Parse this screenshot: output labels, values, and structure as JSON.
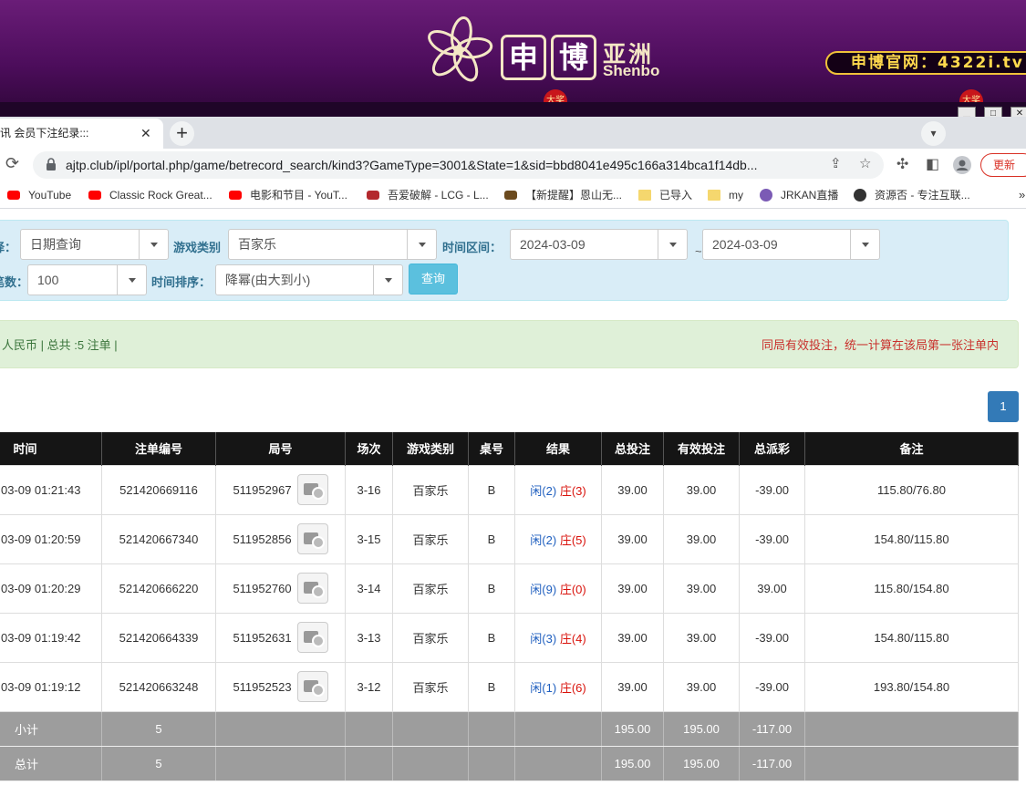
{
  "banner": {
    "brand_box_1": "申",
    "brand_box_2": "博",
    "brand_asia": "亚洲",
    "brand_en": "Shenbo",
    "site_url": "申博官网：4322i.tv",
    "hot_badge": "大奖",
    "colors": {
      "background": "#4d0d5c",
      "gold": "#f0c23a"
    }
  },
  "browser": {
    "tab_title": "讯 会员下注纪录:::",
    "url": "ajtp.club/ipl/portal.php/game/betrecord_search/kind3?GameType=3001&State=1&sid=bbd8041e495c166a314bca1f14db...",
    "update_label": "更新",
    "bookmarks": [
      {
        "label": "YouTube",
        "icon": "youtube-icon"
      },
      {
        "label": "Classic Rock Great...",
        "icon": "youtube-icon"
      },
      {
        "label": "电影和节目 - YouT...",
        "icon": "youtube-icon"
      },
      {
        "label": "吾爱破解 - LCG - L...",
        "icon": "site-icon"
      },
      {
        "label": "【新提醒】恩山无...",
        "icon": "site-icon"
      },
      {
        "label": "已导入",
        "icon": "folder-icon"
      },
      {
        "label": "my",
        "icon": "folder-icon"
      },
      {
        "label": "JRKAN直播",
        "icon": "site-icon"
      },
      {
        "label": "资源否 - 专注互联...",
        "icon": "site-icon"
      }
    ]
  },
  "filter": {
    "label_mode": "择：",
    "mode_value": "日期查询",
    "label_game": "游戏类别",
    "game_value": "百家乐",
    "label_range": "时间区间：",
    "date_from": "2024-03-09",
    "range_sep": "~",
    "date_to": "2024-03-09",
    "label_count": "笔数：",
    "count_value": "100",
    "label_sort": "时间排序：",
    "sort_value": "降幂(由大到小)",
    "query_label": "查询"
  },
  "summary": {
    "left": "人民币 | 总共 :5 注单 |",
    "right": "同局有效投注，统一计算在该局第一张注单内"
  },
  "pagination": {
    "current": "1"
  },
  "table": {
    "headers": [
      "时间",
      "注单编号",
      "局号",
      "场次",
      "游戏类别",
      "桌号",
      "结果",
      "总投注",
      "有效投注",
      "总派彩",
      "备注"
    ],
    "rows": [
      {
        "time": "03-09 01:21:43",
        "bet_no": "521420669116",
        "round": "511952967",
        "session": "3-16",
        "game": "百家乐",
        "table": "B",
        "res_p": "闲(2)",
        "res_b": "庄(3)",
        "total_bet": "39.00",
        "valid_bet": "39.00",
        "payout": "-39.00",
        "remark": "115.80/76.80"
      },
      {
        "time": "03-09 01:20:59",
        "bet_no": "521420667340",
        "round": "511952856",
        "session": "3-15",
        "game": "百家乐",
        "table": "B",
        "res_p": "闲(2)",
        "res_b": "庄(5)",
        "total_bet": "39.00",
        "valid_bet": "39.00",
        "payout": "-39.00",
        "remark": "154.80/115.80"
      },
      {
        "time": "03-09 01:20:29",
        "bet_no": "521420666220",
        "round": "511952760",
        "session": "3-14",
        "game": "百家乐",
        "table": "B",
        "res_p": "闲(9)",
        "res_b": "庄(0)",
        "total_bet": "39.00",
        "valid_bet": "39.00",
        "payout": "39.00",
        "remark": "115.80/154.80"
      },
      {
        "time": "03-09 01:19:42",
        "bet_no": "521420664339",
        "round": "511952631",
        "session": "3-13",
        "game": "百家乐",
        "table": "B",
        "res_p": "闲(3)",
        "res_b": "庄(4)",
        "total_bet": "39.00",
        "valid_bet": "39.00",
        "payout": "-39.00",
        "remark": "154.80/115.80"
      },
      {
        "time": "03-09 01:19:12",
        "bet_no": "521420663248",
        "round": "511952523",
        "session": "3-12",
        "game": "百家乐",
        "table": "B",
        "res_p": "闲(1)",
        "res_b": "庄(6)",
        "total_bet": "39.00",
        "valid_bet": "39.00",
        "payout": "-39.00",
        "remark": "193.80/154.80"
      }
    ],
    "subtotal": {
      "label": "小计",
      "count": "5",
      "total_bet": "195.00",
      "valid_bet": "195.00",
      "payout": "-117.00"
    },
    "total": {
      "label": "总计",
      "count": "5",
      "total_bet": "195.00",
      "valid_bet": "195.00",
      "payout": "-117.00"
    }
  }
}
